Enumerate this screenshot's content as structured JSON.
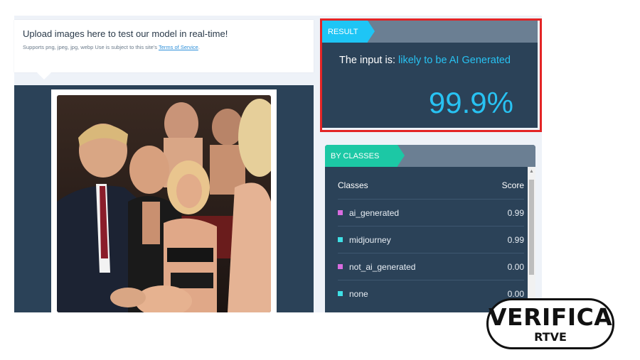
{
  "upload": {
    "title": "Upload images here to test our model in real-time!",
    "subtitle_prefix": "Supports png, jpeg, jpg, webp Use is subject to this site's ",
    "tos_link": "Terms of Service",
    "subtitle_suffix": "."
  },
  "result": {
    "tag": "RESULT",
    "prefix": "The input is: ",
    "verdict": "likely to be AI Generated",
    "score": "99.9%"
  },
  "classes": {
    "tag": "BY CLASSES",
    "col_class": "Classes",
    "col_score": "Score",
    "rows": [
      {
        "label": "ai_generated",
        "score": "0.99",
        "color": "#d96ce0"
      },
      {
        "label": "midjourney",
        "score": "0.99",
        "color": "#3fe0e6"
      },
      {
        "label": "not_ai_generated",
        "score": "0.00",
        "color": "#d96ce0"
      },
      {
        "label": "none",
        "score": "0.00",
        "color": "#3fe0e6"
      }
    ]
  },
  "logo": {
    "top": "VERIFICA",
    "bottom": "RTVE"
  },
  "colors": {
    "panel": "#2b4258",
    "accent": "#28c2f2",
    "highlight_border": "#e32526"
  }
}
